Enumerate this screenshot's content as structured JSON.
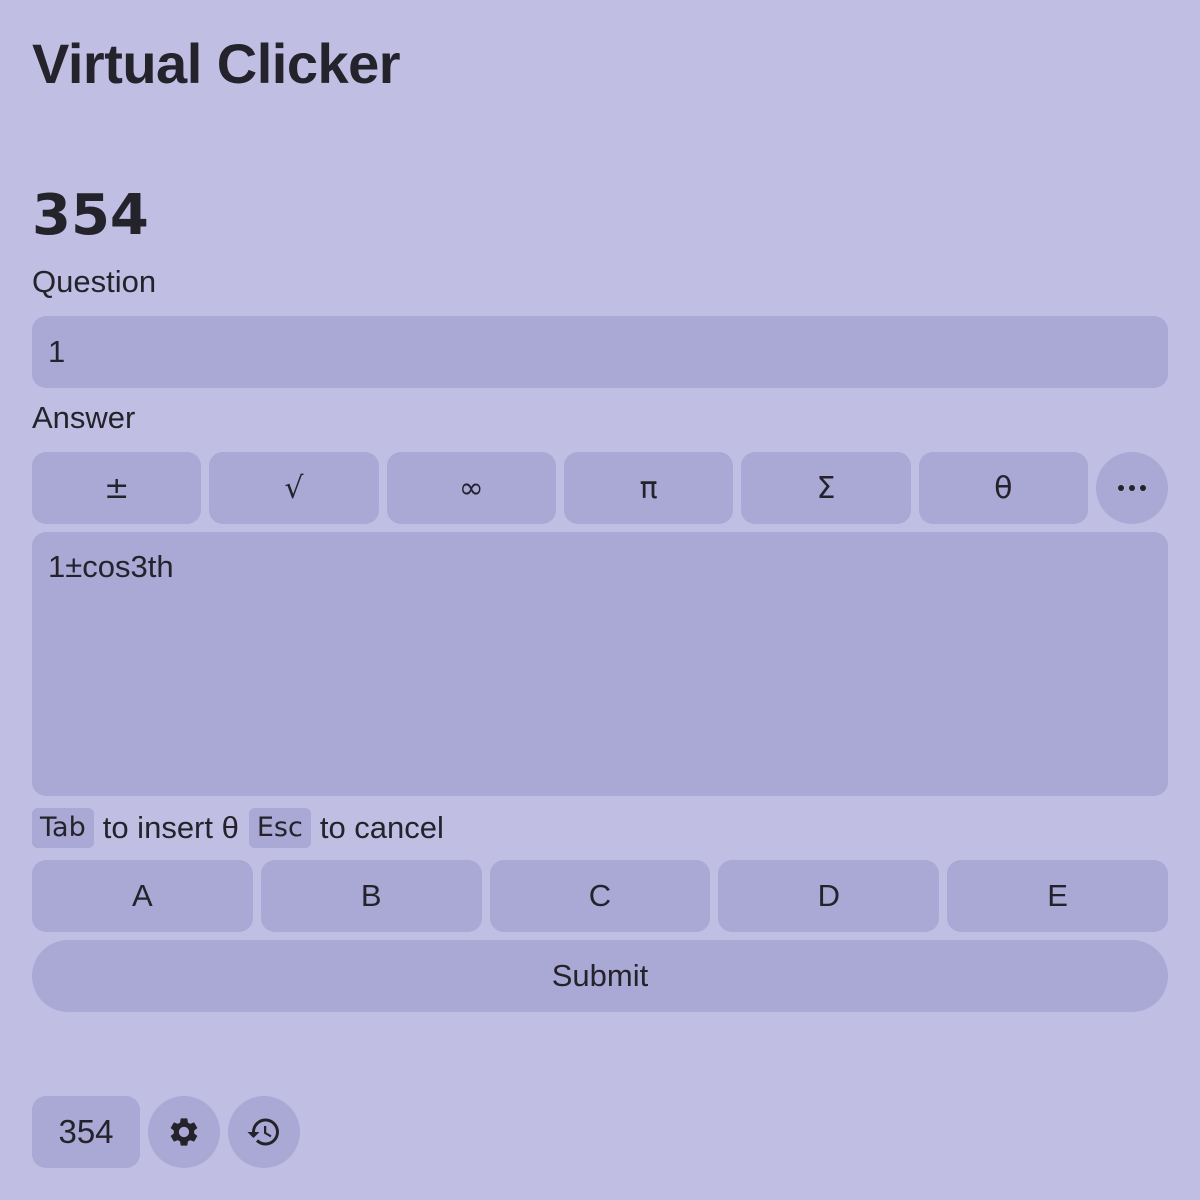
{
  "app": {
    "title": "Virtual Clicker",
    "room_code": "354"
  },
  "question": {
    "label": "Question",
    "value": "1"
  },
  "answer": {
    "label": "Answer",
    "value": "1±cos3th",
    "symbols": [
      "±",
      "√",
      "∞",
      "π",
      "Σ",
      "θ"
    ],
    "more_icon": "more-horizontal-icon"
  },
  "hint": {
    "tab_key": "Tab",
    "tab_text": "to insert θ",
    "esc_key": "Esc",
    "esc_text": "to cancel"
  },
  "choices": [
    "A",
    "B",
    "C",
    "D",
    "E"
  ],
  "submit_label": "Submit",
  "footer": {
    "room_code": "354",
    "settings_icon": "gear-icon",
    "history_icon": "history-icon"
  },
  "colors": {
    "background": "#c1bee4",
    "control": "#aaa8d4",
    "text": "#24232b"
  }
}
